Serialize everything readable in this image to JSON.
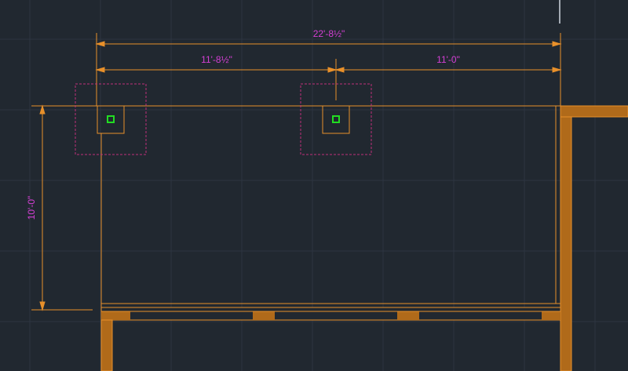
{
  "colors": {
    "background": "#212830",
    "grid": "#2d3541",
    "dimension_line": "#e8902a",
    "dimension_text": "#d43fd4",
    "wall": "#c8781e",
    "wall_fill": "#b06a1a",
    "column_box": "#c0307a",
    "column_marker": "#22dd22"
  },
  "dimensions": {
    "overall_width": "22'-8½\"",
    "left_span": "11'-8½\"",
    "right_span": "11'-0\"",
    "height": "10'-0\""
  }
}
